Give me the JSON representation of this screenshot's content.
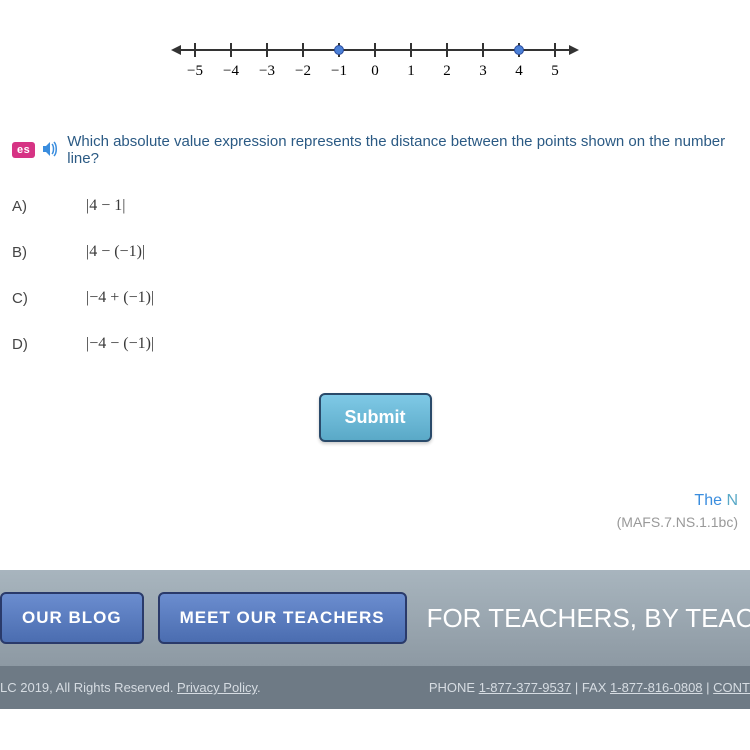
{
  "question": {
    "es_badge": "es",
    "text": "Which absolute value expression represents the distance between the points shown on the number line?"
  },
  "number_line": {
    "min": -5,
    "max": 5,
    "ticks": [
      "−5",
      "−4",
      "−3",
      "−2",
      "−1",
      "0",
      "1",
      "2",
      "3",
      "4",
      "5"
    ],
    "points": [
      -1,
      4
    ]
  },
  "options": [
    {
      "label": "A)",
      "expr": "|4 − 1|"
    },
    {
      "label": "B)",
      "expr": "|4 − (−1)|"
    },
    {
      "label": "C)",
      "expr": "|−4 + (−1)|"
    },
    {
      "label": "D)",
      "expr": "|−4 − (−1)|"
    }
  ],
  "submit_label": "Submit",
  "standard": {
    "line1_prefix": "The ",
    "line1_rest": "N",
    "code": "(MAFS.7.NS.1.1bc)"
  },
  "footer": {
    "blog_btn": "OUR BLOG",
    "teachers_btn": "MEET OUR TEACHERS",
    "tagline": "FOR TEACHERS, BY TEAC",
    "copyright_prefix": "LC 2019, All Rights Reserved. ",
    "privacy": "Privacy Policy",
    "copyright_suffix": ".",
    "phone_label": "PHONE ",
    "phone": "1-877-377-9537",
    "fax_sep": " | FAX ",
    "fax": "1-877-816-0808",
    "cont_sep": " | ",
    "cont": "CONT"
  }
}
